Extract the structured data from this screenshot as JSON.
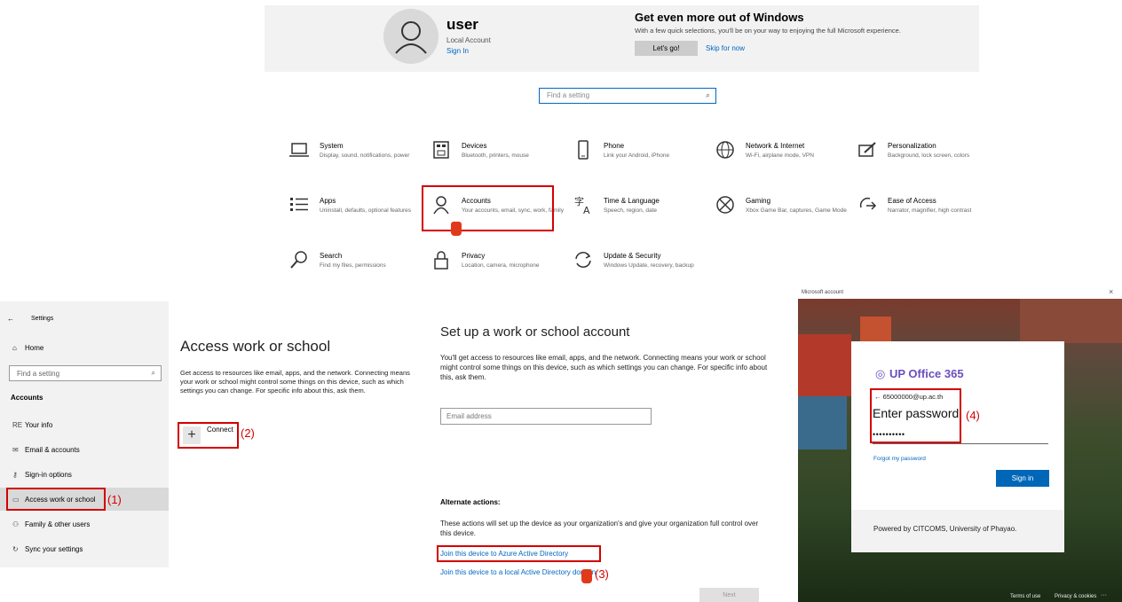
{
  "home": {
    "user_name": "user",
    "user_type": "Local Account",
    "sign_in": "Sign In",
    "promo_title": "Get even more out of Windows",
    "promo_text": "With a few quick selections, you'll be on your way to enjoying the full Microsoft experience.",
    "promo_button": "Let's go!",
    "promo_skip": "Skip for now",
    "search_placeholder": "Find a setting",
    "categories": [
      {
        "title": "System",
        "desc": "Display, sound, notifications, power",
        "icon": "laptop-icon"
      },
      {
        "title": "Devices",
        "desc": "Bluetooth, printers, mouse",
        "icon": "keyboard-icon"
      },
      {
        "title": "Phone",
        "desc": "Link your Android, iPhone",
        "icon": "phone-icon"
      },
      {
        "title": "Network & Internet",
        "desc": "Wi-Fi, airplane mode, VPN",
        "icon": "globe-icon"
      },
      {
        "title": "Personalization",
        "desc": "Background, lock screen, colors",
        "icon": "paint-icon"
      },
      {
        "title": "Apps",
        "desc": "Uninstall, defaults, optional features",
        "icon": "apps-list-icon"
      },
      {
        "title": "Accounts",
        "desc": "Your accounts, email, sync, work, family",
        "icon": "person-icon"
      },
      {
        "title": "Time & Language",
        "desc": "Speech, region, date",
        "icon": "time-language-icon"
      },
      {
        "title": "Gaming",
        "desc": "Xbox Game Bar, captures, Game Mode",
        "icon": "xbox-icon"
      },
      {
        "title": "Ease of Access",
        "desc": "Narrator, magnifier, high contrast",
        "icon": "ease-of-access-icon"
      },
      {
        "title": "Search",
        "desc": "Find my files, permissions",
        "icon": "search-icon"
      },
      {
        "title": "Privacy",
        "desc": "Location, camera, microphone",
        "icon": "lock-icon"
      },
      {
        "title": "Update & Security",
        "desc": "Windows Update, recovery, backup",
        "icon": "sync-icon"
      }
    ]
  },
  "left_pane": {
    "back_icon": "←",
    "title": "Settings",
    "home": "Home",
    "search_placeholder": "Find a setting",
    "section": "Accounts",
    "nav": [
      {
        "label": "Your info",
        "icon": "RE"
      },
      {
        "label": "Email & accounts",
        "icon": "✉"
      },
      {
        "label": "Sign-in options",
        "icon": "⚷"
      },
      {
        "label": "Access work or school",
        "icon": "▭"
      },
      {
        "label": "Family & other users",
        "icon": "⚇"
      },
      {
        "label": "Sync your settings",
        "icon": "↻"
      }
    ],
    "step1": "(1)"
  },
  "access_work": {
    "title": "Access work or school",
    "text": "Get access to resources like email, apps, and the network. Connecting means your work or school might control some things on this device, such as which settings you can change. For specific info about this, ask them.",
    "connect": "Connect",
    "step2": "(2)"
  },
  "setup": {
    "title": "Set up a work or school account",
    "text": "You'll get access to resources like email, apps, and the network. Connecting means your work or school might control some things on this device, such as which settings you can change. For specific info about this, ask them.",
    "email_placeholder": "Email address",
    "alt_title": "Alternate actions:",
    "alt_text": "These actions will set up the device as your organization's and give your organization full control over this device.",
    "join_azure": "Join this device to Azure Active Directory",
    "join_local": "Join this device to a local Active Directory domain",
    "step3": "(3)",
    "next": "Next"
  },
  "ms_dialog": {
    "window_title": "Microsoft account",
    "close": "×",
    "brand": "UP Office 365",
    "email": "← 65000000@up.ac.th",
    "heading": "Enter password",
    "password": "••••••••••",
    "forgot": "Forgot my password",
    "sign_in": "Sign in",
    "powered": "Powered by CITCOMS, University of Phayao.",
    "terms": "Terms of use",
    "privacy": "Privacy & cookies",
    "more": "···",
    "step4": "(4)"
  },
  "colors": {
    "accent": "#0067c0",
    "highlight": "#d40000",
    "brand": "#6b4fbb"
  }
}
